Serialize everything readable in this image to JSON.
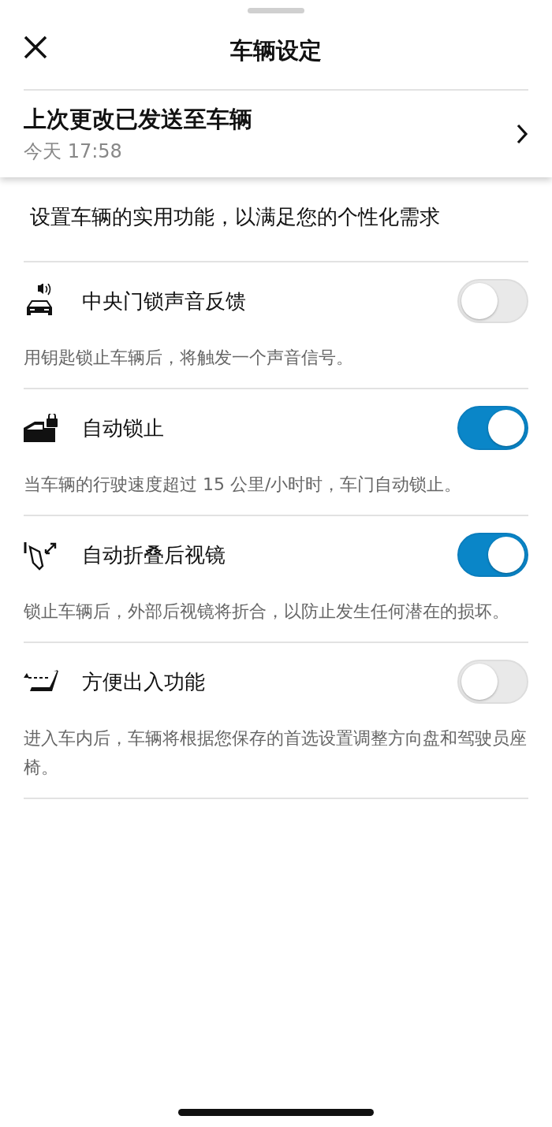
{
  "header": {
    "title": "车辆设定"
  },
  "last_change": {
    "title": "上次更改已发送至车辆",
    "time": "今天 17:58"
  },
  "intro": "设置车辆的实用功能，以满足您的个性化需求",
  "settings": [
    {
      "title": "中央门锁声音反馈",
      "description": "用钥匙锁止车辆后，将触发一个声音信号。",
      "on": false
    },
    {
      "title": "自动锁止",
      "description": "当车辆的行驶速度超过 15 公里/小时时，车门自动锁止。",
      "on": true
    },
    {
      "title": "自动折叠后视镜",
      "description": "锁止车辆后，外部后视镜将折合，以防止发生任何潜在的损坏。",
      "on": true
    },
    {
      "title": "方便出入功能",
      "description": "进入车内后，车辆将根据您保存的首选设置调整方向盘和驾驶员座椅。",
      "on": false
    }
  ]
}
